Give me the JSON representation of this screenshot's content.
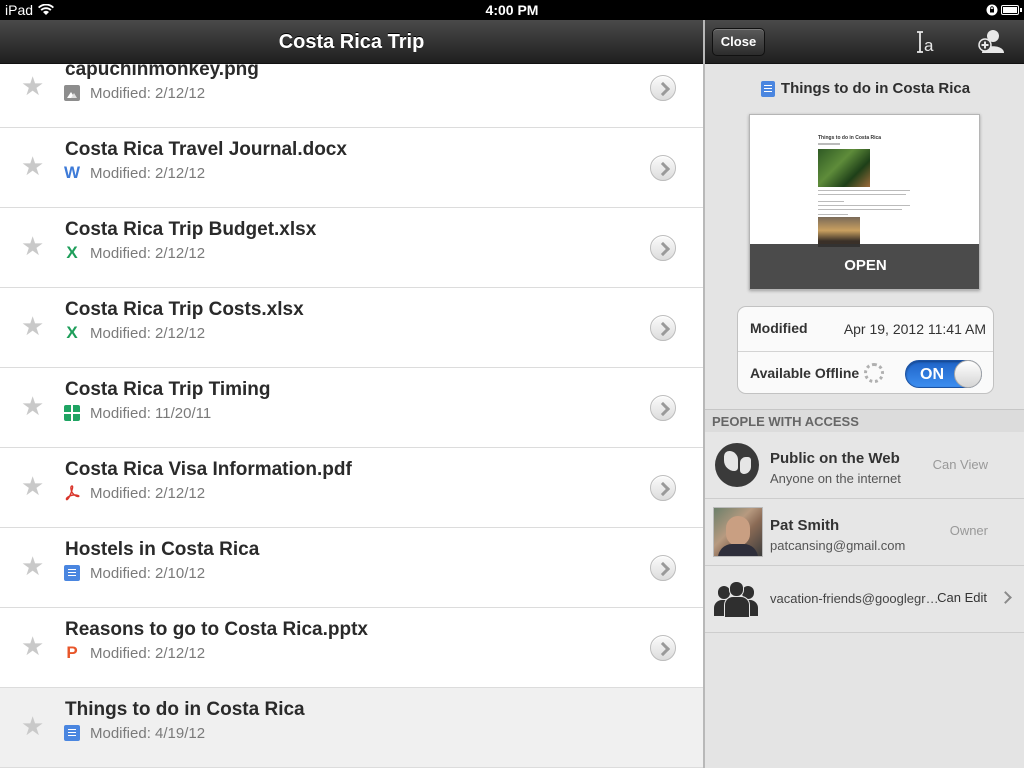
{
  "status_bar": {
    "carrier": "iPad",
    "time": "4:00 PM"
  },
  "nav": {
    "title": "Costa Rica Trip"
  },
  "files": [
    {
      "name": "capuchinmonkey.png",
      "modified": "Modified: 2/12/12",
      "icon": "image-icon",
      "icon_char": ""
    },
    {
      "name": "Costa Rica Travel Journal.docx",
      "modified": "Modified: 2/12/12",
      "icon": "word-icon",
      "icon_char": "W"
    },
    {
      "name": "Costa Rica Trip Budget.xlsx",
      "modified": "Modified: 2/12/12",
      "icon": "excel-icon",
      "icon_char": "X"
    },
    {
      "name": "Costa Rica Trip Costs.xlsx",
      "modified": "Modified: 2/12/12",
      "icon": "excel-icon",
      "icon_char": "X"
    },
    {
      "name": "Costa Rica Trip Timing",
      "modified": "Modified: 11/20/11",
      "icon": "spreadsheet-icon",
      "icon_char": ""
    },
    {
      "name": "Costa Rica Visa Information.pdf",
      "modified": "Modified: 2/12/12",
      "icon": "pdf-icon",
      "icon_char": "†"
    },
    {
      "name": "Hostels in Costa Rica",
      "modified": "Modified: 2/10/12",
      "icon": "document-icon",
      "icon_char": ""
    },
    {
      "name": "Reasons to go to Costa Rica.pptx",
      "modified": "Modified: 2/12/12",
      "icon": "powerpoint-icon",
      "icon_char": "P"
    },
    {
      "name": "Things to do in Costa Rica",
      "modified": "Modified: 4/19/12",
      "icon": "document-icon",
      "icon_char": "",
      "selected": true
    }
  ],
  "details": {
    "close_label": "Close",
    "doc_title": "Things to do in Costa Rica",
    "preview": {
      "title": "Things to do in Costa Rica",
      "open_label": "OPEN"
    },
    "modified_label": "Modified",
    "modified_value": "Apr 19, 2012 11:41 AM",
    "offline_label": "Available Offline",
    "offline_toggle": "ON"
  },
  "people": {
    "header": "PEOPLE WITH ACCESS",
    "entries": [
      {
        "name": "Public on the Web",
        "sub": "Anyone on the internet",
        "role": "Can View"
      },
      {
        "name": "Pat Smith",
        "sub": "patcansing@gmail.com",
        "role": "Owner"
      },
      {
        "email": "vacation-friends@googlegroups.com",
        "role": "Can Edit"
      }
    ]
  },
  "colors": {
    "word": "#3e7bd8",
    "excel": "#1e9e5a",
    "spreadsheet": "#1fa463",
    "pdf": "#d9352b",
    "powerpoint": "#e8562a",
    "docs": "#4a86e0",
    "toggle_on": "#2f7fe6"
  }
}
